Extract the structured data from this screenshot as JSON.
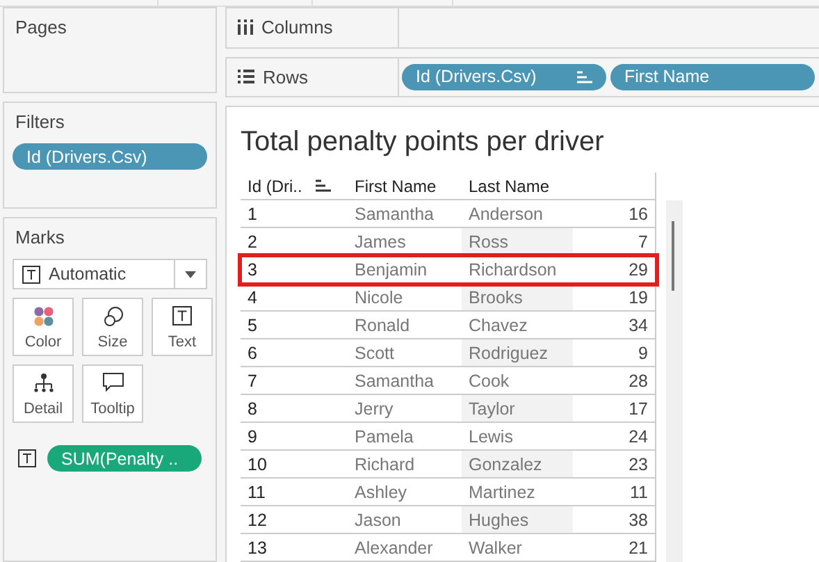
{
  "pages": {
    "title": "Pages"
  },
  "filters": {
    "title": "Filters",
    "pills": [
      "Id (Drivers.Csv)"
    ]
  },
  "marks": {
    "title": "Marks",
    "mark_type": "Automatic",
    "cards": [
      {
        "kind": "color",
        "label": "Color"
      },
      {
        "kind": "size",
        "label": "Size"
      },
      {
        "kind": "text",
        "label": "Text"
      },
      {
        "kind": "detail",
        "label": "Detail"
      },
      {
        "kind": "tooltip",
        "label": "Tooltip"
      }
    ],
    "fields": [
      {
        "kind": "text",
        "label": "SUM(Penalty .."
      }
    ]
  },
  "shelves": [
    {
      "kind": "columns",
      "label": "Columns"
    },
    {
      "kind": "rows",
      "label": "Rows",
      "pills": [
        {
          "label": "Id (Drivers.Csv)",
          "sorted": true
        },
        {
          "label": "First Name",
          "sorted": false
        }
      ]
    }
  ],
  "view": {
    "title": "Total penalty points per driver",
    "columns": [
      {
        "label": "Id (Dri..",
        "sorted": true
      },
      {
        "label": "First Name",
        "sorted": false
      },
      {
        "label": "Last Name",
        "sorted": false
      }
    ],
    "rows": [
      {
        "cells": [
          "1",
          "Samantha",
          "Anderson",
          "16"
        ],
        "highlighted": false
      },
      {
        "cells": [
          "2",
          "James",
          "Ross",
          "7"
        ],
        "highlighted": false
      },
      {
        "cells": [
          "3",
          "Benjamin",
          "Richardson",
          "29"
        ],
        "highlighted": true
      },
      {
        "cells": [
          "4",
          "Nicole",
          "Brooks",
          "19"
        ],
        "highlighted": false
      },
      {
        "cells": [
          "5",
          "Ronald",
          "Chavez",
          "34"
        ],
        "highlighted": false
      },
      {
        "cells": [
          "6",
          "Scott",
          "Rodriguez",
          "9"
        ],
        "highlighted": false
      },
      {
        "cells": [
          "7",
          "Samantha",
          "Cook",
          "28"
        ],
        "highlighted": false
      },
      {
        "cells": [
          "8",
          "Jerry",
          "Taylor",
          "17"
        ],
        "highlighted": false
      },
      {
        "cells": [
          "9",
          "Pamela",
          "Lewis",
          "24"
        ],
        "highlighted": false
      },
      {
        "cells": [
          "10",
          "Richard",
          "Gonzalez",
          "23"
        ],
        "highlighted": false
      },
      {
        "cells": [
          "11",
          "Ashley",
          "Martinez",
          "11"
        ],
        "highlighted": false
      },
      {
        "cells": [
          "12",
          "Jason",
          "Hughes",
          "38"
        ],
        "highlighted": false
      },
      {
        "cells": [
          "13",
          "Alexander",
          "Walker",
          "21"
        ],
        "highlighted": false
      }
    ]
  }
}
